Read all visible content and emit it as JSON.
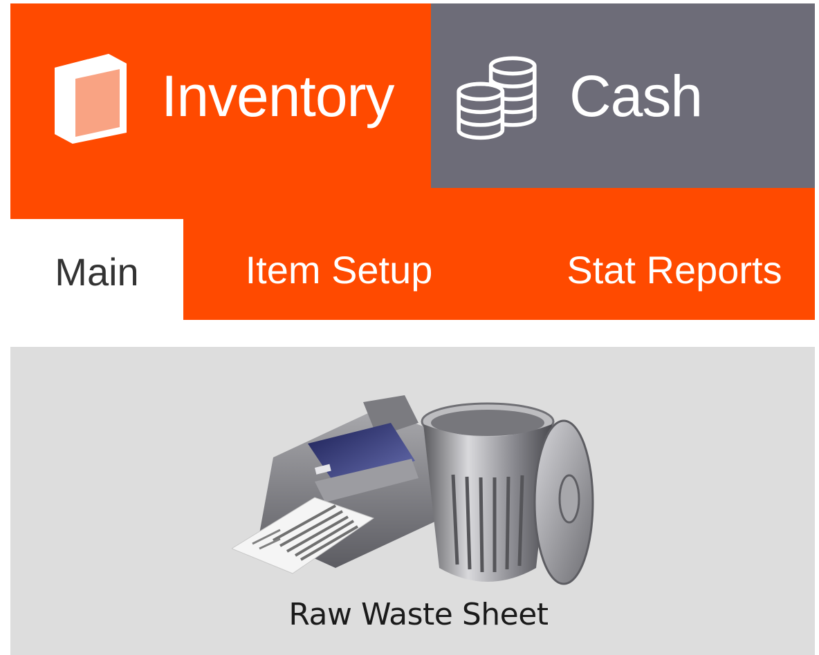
{
  "modules": {
    "inventory": {
      "label": "Inventory",
      "icon": "box-icon",
      "active": true
    },
    "cash": {
      "label": "Cash",
      "icon": "coins-icon",
      "active": false
    }
  },
  "subtabs": [
    {
      "label": "Main",
      "active": true
    },
    {
      "label": "Item Setup",
      "active": false
    },
    {
      "label": "Stat Reports",
      "active": false
    }
  ],
  "tiles": [
    {
      "label": "Raw Waste Sheet",
      "icon": "printer-trash-icon"
    }
  ],
  "colors": {
    "accent": "#ff4a00",
    "inactive_module": "#6d6c78",
    "content_bg": "#dddddd"
  }
}
